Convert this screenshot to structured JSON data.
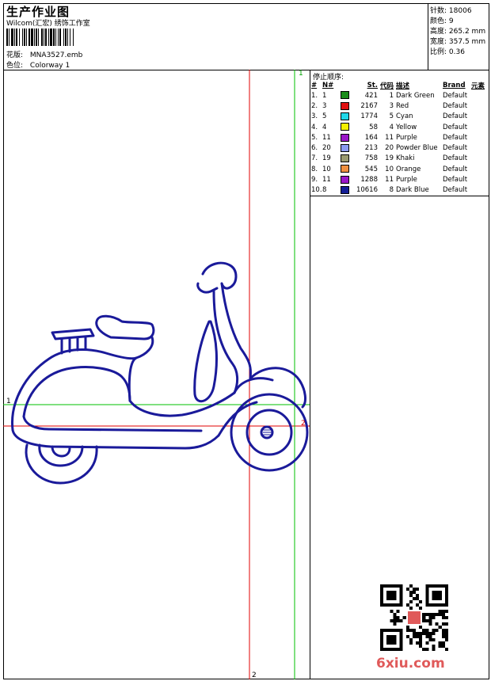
{
  "header": {
    "title": "生产作业图",
    "studio": "Wilcom(汇宏) 绣饰工作室",
    "design_label": "花版:",
    "design_file": "MNA3527.emb",
    "colorway_label": "色位:",
    "colorway": "Colorway 1"
  },
  "stats": {
    "stitches_label": "针数:",
    "stitches": "18006",
    "colors_label": "颜色:",
    "colors": "9",
    "height_label": "高度:",
    "height": "265.2 mm",
    "width_label": "宽度:",
    "width": "357.5 mm",
    "scale_label": "比例:",
    "scale": "0.36"
  },
  "stop_sequence": {
    "title": "停止顺序:",
    "headers": [
      "#",
      "N#",
      "St.",
      "代码",
      "描述",
      "Brand",
      "元素"
    ],
    "rows": [
      {
        "idx": "1.",
        "n": "1",
        "color": "#1a8c1a",
        "st": "421",
        "code": "1",
        "desc": "Dark Green",
        "brand": "Default"
      },
      {
        "idx": "2.",
        "n": "3",
        "color": "#e01010",
        "st": "2167",
        "code": "3",
        "desc": "Red",
        "brand": "Default"
      },
      {
        "idx": "3.",
        "n": "5",
        "color": "#20d8e8",
        "st": "1774",
        "code": "5",
        "desc": "Cyan",
        "brand": "Default"
      },
      {
        "idx": "4.",
        "n": "4",
        "color": "#f4f000",
        "st": "58",
        "code": "4",
        "desc": "Yellow",
        "brand": "Default"
      },
      {
        "idx": "5.",
        "n": "11",
        "color": "#9a18c8",
        "st": "164",
        "code": "11",
        "desc": "Purple",
        "brand": "Default"
      },
      {
        "idx": "6.",
        "n": "20",
        "color": "#8a9af0",
        "st": "213",
        "code": "20",
        "desc": "Powder Blue",
        "brand": "Default"
      },
      {
        "idx": "7.",
        "n": "19",
        "color": "#9a9a70",
        "st": "758",
        "code": "19",
        "desc": "Khaki",
        "brand": "Default"
      },
      {
        "idx": "8.",
        "n": "10",
        "color": "#f09040",
        "st": "545",
        "code": "10",
        "desc": "Orange",
        "brand": "Default"
      },
      {
        "idx": "9.",
        "n": "11",
        "color": "#9a18c8",
        "st": "1288",
        "code": "11",
        "desc": "Purple",
        "brand": "Default"
      },
      {
        "idx": "10.",
        "n": "8",
        "color": "#141e96",
        "st": "10616",
        "code": "8",
        "desc": "Dark Blue",
        "brand": "Default"
      }
    ]
  },
  "guides": {
    "label_1_left": "1",
    "label_1_top": "1",
    "label_2_bottom": "2",
    "label_2_right": "2"
  },
  "watermark": "6xiu.com",
  "colors": {
    "outline": "#1a1a9a",
    "guide_red": "#e00000",
    "guide_green": "#00c000"
  }
}
